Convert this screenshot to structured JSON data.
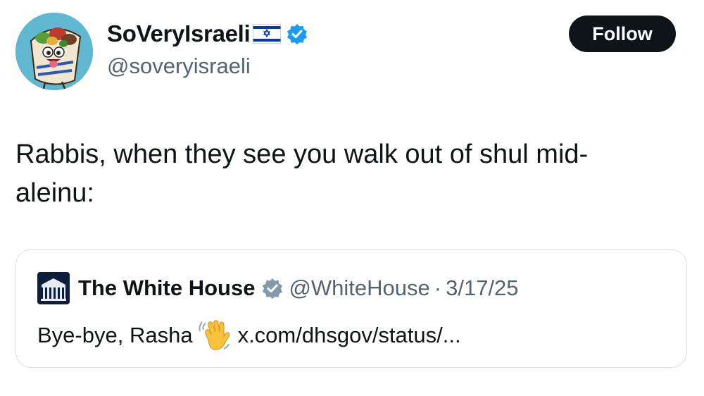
{
  "author": {
    "display_name": "SoVeryIsraeli",
    "handle": "@soveryisraeli",
    "avatar_icon": "cartoon-falafel-avatar",
    "flag_icon": "israel-flag-icon",
    "verified_icon": "verified-badge-icon",
    "verified_color": "#1d9bf0"
  },
  "follow_button": {
    "label": "Follow",
    "bg": "#0f1419",
    "fg": "#ffffff"
  },
  "tweet": {
    "text_line1": "Rabbis, when they see you walk out of shul mid-",
    "text_line2": "aleinu:"
  },
  "quote_tweet": {
    "display_name": "The White House",
    "handle": "@WhiteHouse",
    "separator": "·",
    "date": "3/17/25",
    "verified_icon": "gray-verified-badge-icon",
    "avatar_icon": "white-house-building-icon",
    "text_prefix": "Bye-bye, Rasha",
    "emoji": "waving-hand-icon",
    "link": "x.com/dhsgov/status/..."
  }
}
